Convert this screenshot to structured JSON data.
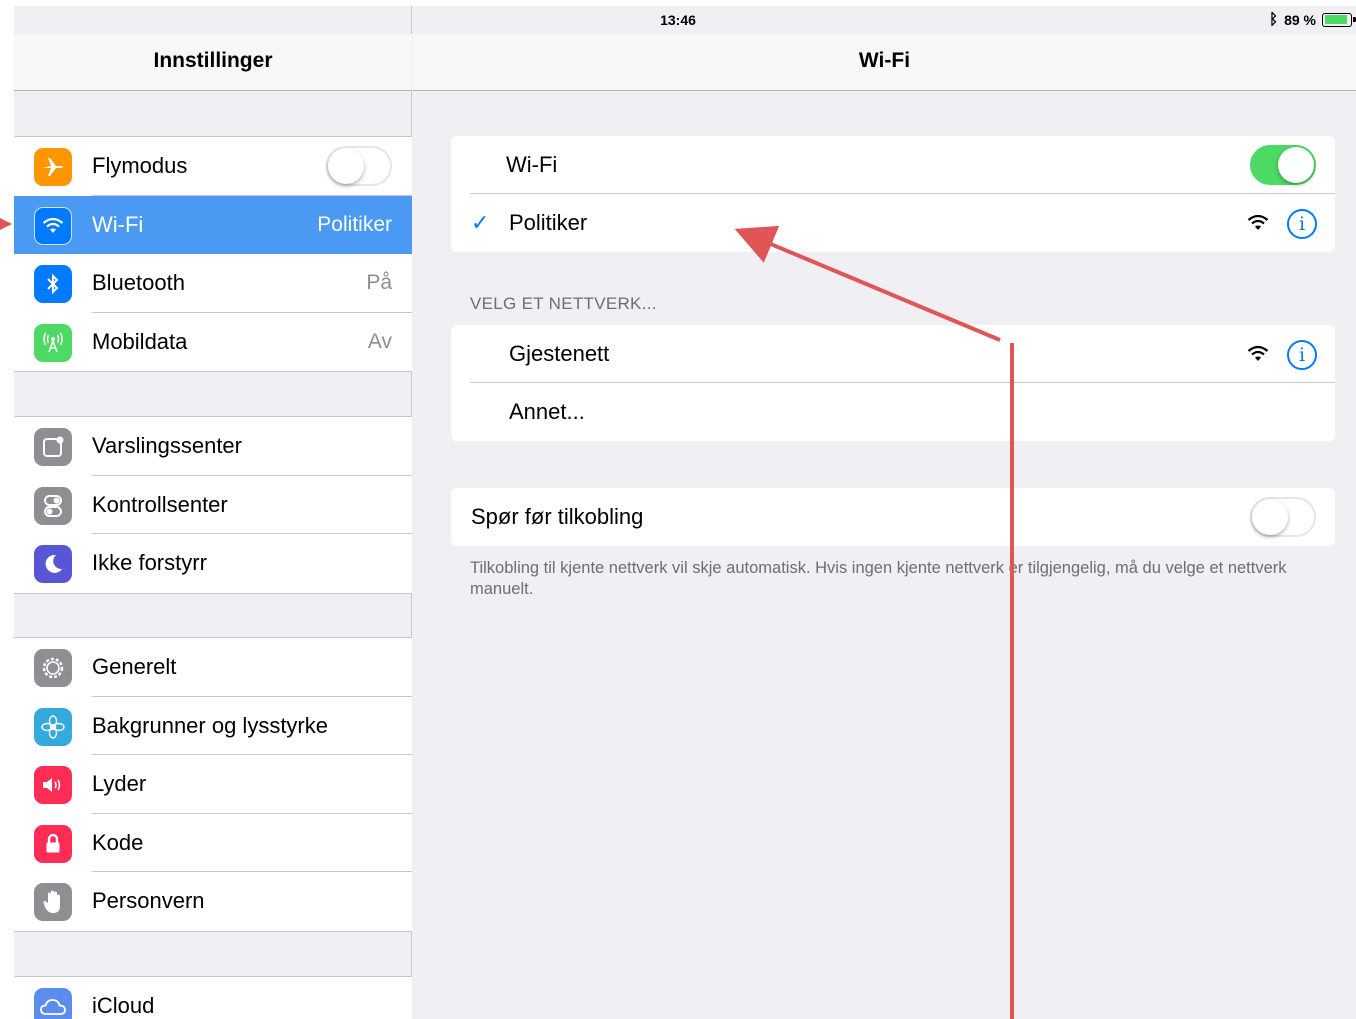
{
  "statusbar": {
    "device": "iPad",
    "time": "13:46",
    "battery": "89 %",
    "battery_level": 0.89
  },
  "sidebar": {
    "title": "Innstillinger",
    "groups": [
      [
        {
          "label": "Flymodus",
          "icon": "airplane-icon",
          "color": "#ff9500",
          "toggle": false
        },
        {
          "label": "Wi-Fi",
          "icon": "wifi-icon",
          "color": "#007aff",
          "value": "Politiker",
          "selected": true
        },
        {
          "label": "Bluetooth",
          "icon": "bluetooth-icon",
          "color": "#007aff",
          "value": "På"
        },
        {
          "label": "Mobildata",
          "icon": "cellular-icon",
          "color": "#4cd964",
          "value": "Av"
        }
      ],
      [
        {
          "label": "Varslingssenter",
          "icon": "notification-center-icon",
          "color": "#8e8e93"
        },
        {
          "label": "Kontrollsenter",
          "icon": "control-center-icon",
          "color": "#8e8e93"
        },
        {
          "label": "Ikke forstyrr",
          "icon": "moon-icon",
          "color": "#5856d6"
        }
      ],
      [
        {
          "label": "Generelt",
          "icon": "gear-icon",
          "color": "#8e8e93"
        },
        {
          "label": "Bakgrunner og lysstyrke",
          "icon": "flower-icon",
          "color": "#34aadc"
        },
        {
          "label": "Lyder",
          "icon": "speaker-icon",
          "color": "#ff2d55"
        },
        {
          "label": "Kode",
          "icon": "lock-icon",
          "color": "#ff2d55"
        },
        {
          "label": "Personvern",
          "icon": "hand-icon",
          "color": "#8e8e93"
        }
      ],
      [
        {
          "label": "iCloud",
          "icon": "cloud-icon",
          "color": "#5b8def"
        }
      ]
    ]
  },
  "detail": {
    "title": "Wi-Fi",
    "wifi_label": "Wi-Fi",
    "wifi_on": true,
    "connected_network": "Politiker",
    "section_header": "VELG ET NETTVERK...",
    "networks": [
      {
        "name": "Gjestenett"
      },
      {
        "name": "Annet..."
      }
    ],
    "ask_label": "Spør før tilkobling",
    "ask_on": false,
    "footnote": "Tilkobling til kjente nettverk vil skje automatisk. Hvis ingen kjente nettverk er tilgjengelig, må du velge et nettverk manuelt."
  },
  "colors": {
    "accent": "#007aff",
    "selected_row": "#4a9af3",
    "toggle_on": "#4cd964",
    "annotation": "#e05555"
  }
}
